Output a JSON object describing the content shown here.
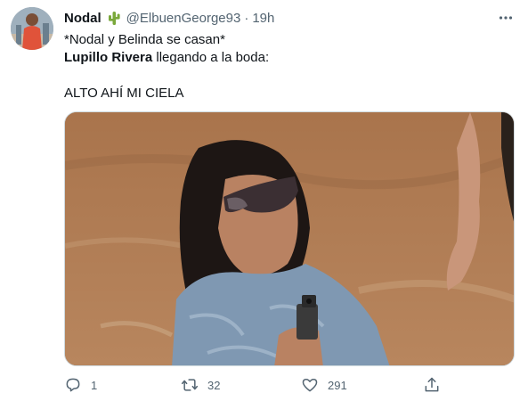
{
  "tweet": {
    "display_name": "Nodal",
    "handle": "@ElbuenGeorge93",
    "separator": "·",
    "time": "19h",
    "line1": "*Nodal y Belinda se casan*",
    "line2_bold": "Lupillo Rivera",
    "line2_rest": " llegando a la boda:",
    "line3": "ALTO AHÍ MI CIELA"
  },
  "icons": {
    "name_emoji": "cactus-icon",
    "more": "more-horizontal-icon",
    "reply": "reply-icon",
    "retweet": "retweet-icon",
    "like": "heart-icon",
    "share": "share-icon"
  },
  "actions": {
    "replies": "1",
    "retweets": "32",
    "likes": "291"
  },
  "colors": {
    "text": "#0f1419",
    "secondary": "#536471",
    "cactus": "#7aa83b",
    "border": "#cfd9de"
  }
}
